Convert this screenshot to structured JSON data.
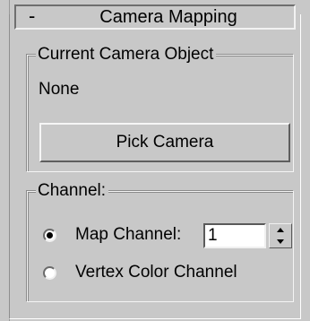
{
  "rollout": {
    "collapse_sign": "-",
    "title": "Camera Mapping"
  },
  "current_camera": {
    "legend": "Current Camera Object",
    "value": "None",
    "pick_button_label": "Pick Camera"
  },
  "channel": {
    "legend": "Channel:",
    "map_channel_label": "Map Channel:",
    "map_channel_value": "1",
    "map_channel_selected": true,
    "vertex_color_label": "Vertex Color Channel",
    "vertex_color_selected": false
  }
}
